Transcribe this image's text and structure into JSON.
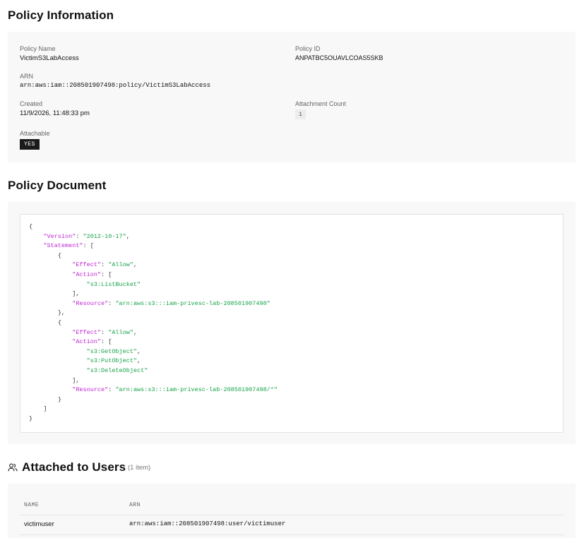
{
  "policy_info": {
    "title": "Policy Information",
    "policy_name_label": "Policy Name",
    "policy_name": "VictimS3LabAccess",
    "policy_id_label": "Policy ID",
    "policy_id": "ANPATBC5OUAVLCOAS5SKB",
    "arn_label": "ARN",
    "arn": "arn:aws:iam::208501907498:policy/VictimS3LabAccess",
    "created_label": "Created",
    "created": "11/9/2026, 11:48:33 pm",
    "attachment_count_label": "Attachment Count",
    "attachment_count": "1",
    "attachable_label": "Attachable",
    "attachable": "YES"
  },
  "policy_document": {
    "title": "Policy Document",
    "lines": [
      {
        "indent": 0,
        "parts": [
          {
            "t": "p",
            "v": "{"
          }
        ]
      },
      {
        "indent": 1,
        "parts": [
          {
            "t": "k",
            "v": "\"Version\""
          },
          {
            "t": "p",
            "v": ": "
          },
          {
            "t": "s",
            "v": "\"2012-10-17\""
          },
          {
            "t": "p",
            "v": ","
          }
        ]
      },
      {
        "indent": 1,
        "parts": [
          {
            "t": "k",
            "v": "\"Statement\""
          },
          {
            "t": "p",
            "v": ": ["
          }
        ]
      },
      {
        "indent": 2,
        "parts": [
          {
            "t": "p",
            "v": "{"
          }
        ]
      },
      {
        "indent": 3,
        "parts": [
          {
            "t": "k",
            "v": "\"Effect\""
          },
          {
            "t": "p",
            "v": ": "
          },
          {
            "t": "s",
            "v": "\"Allow\""
          },
          {
            "t": "p",
            "v": ","
          }
        ]
      },
      {
        "indent": 3,
        "parts": [
          {
            "t": "k",
            "v": "\"Action\""
          },
          {
            "t": "p",
            "v": ": ["
          }
        ]
      },
      {
        "indent": 4,
        "parts": [
          {
            "t": "s",
            "v": "\"s3:ListBucket\""
          }
        ]
      },
      {
        "indent": 3,
        "parts": [
          {
            "t": "p",
            "v": "],"
          }
        ]
      },
      {
        "indent": 3,
        "parts": [
          {
            "t": "k",
            "v": "\"Resource\""
          },
          {
            "t": "p",
            "v": ": "
          },
          {
            "t": "s",
            "v": "\"arn:aws:s3:::iam-privesc-lab-208501907498\""
          }
        ]
      },
      {
        "indent": 2,
        "parts": [
          {
            "t": "p",
            "v": "},"
          }
        ]
      },
      {
        "indent": 2,
        "parts": [
          {
            "t": "p",
            "v": "{"
          }
        ]
      },
      {
        "indent": 3,
        "parts": [
          {
            "t": "k",
            "v": "\"Effect\""
          },
          {
            "t": "p",
            "v": ": "
          },
          {
            "t": "s",
            "v": "\"Allow\""
          },
          {
            "t": "p",
            "v": ","
          }
        ]
      },
      {
        "indent": 3,
        "parts": [
          {
            "t": "k",
            "v": "\"Action\""
          },
          {
            "t": "p",
            "v": ": ["
          }
        ]
      },
      {
        "indent": 4,
        "parts": [
          {
            "t": "s",
            "v": "\"s3:GetObject\""
          },
          {
            "t": "p",
            "v": ","
          }
        ]
      },
      {
        "indent": 4,
        "parts": [
          {
            "t": "s",
            "v": "\"s3:PutObject\""
          },
          {
            "t": "p",
            "v": ","
          }
        ]
      },
      {
        "indent": 4,
        "parts": [
          {
            "t": "s",
            "v": "\"s3:DeleteObject\""
          }
        ]
      },
      {
        "indent": 3,
        "parts": [
          {
            "t": "p",
            "v": "],"
          }
        ]
      },
      {
        "indent": 3,
        "parts": [
          {
            "t": "k",
            "v": "\"Resource\""
          },
          {
            "t": "p",
            "v": ": "
          },
          {
            "t": "s",
            "v": "\"arn:aws:s3:::iam-privesc-lab-208501907498/*\""
          }
        ]
      },
      {
        "indent": 2,
        "parts": [
          {
            "t": "p",
            "v": "}"
          }
        ]
      },
      {
        "indent": 1,
        "parts": [
          {
            "t": "p",
            "v": "]"
          }
        ]
      },
      {
        "indent": 0,
        "parts": [
          {
            "t": "p",
            "v": "}"
          }
        ]
      }
    ]
  },
  "attached_users": {
    "title": "Attached to Users",
    "count_note": "(1 item)",
    "icon": "users-icon",
    "columns": {
      "name": "NAME",
      "arn": "ARN"
    },
    "rows": [
      {
        "name": "victimuser",
        "arn": "arn:aws:iam::208501907498:user/victimuser"
      }
    ]
  },
  "colors": {
    "json_key": "#c026d3",
    "json_string": "#16a34a",
    "panel_bg": "#f8f8f8",
    "badge_dark": "#1b1b1b"
  }
}
